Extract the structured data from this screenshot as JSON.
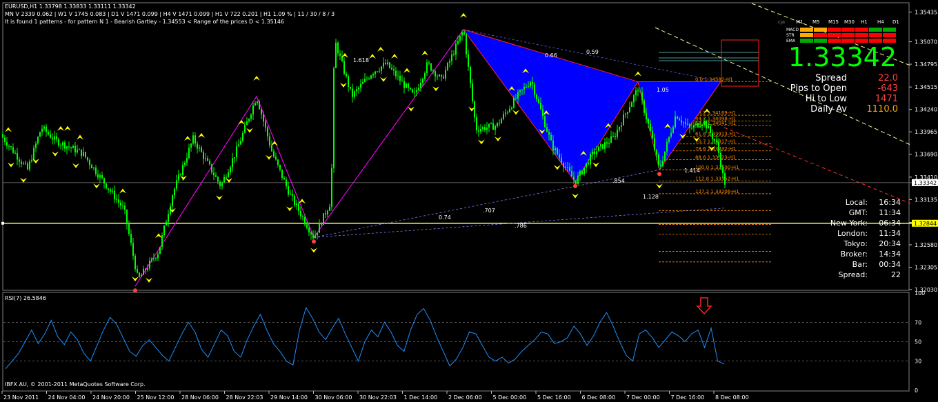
{
  "header": {
    "symbol_line": "EURUSD,H1  1.33798 1.33833 1.33111 1.33342",
    "tf_line": "MN V 2339   0.062  |  W1 V 1745   0.083  |  D1 V 1471   0.099  |  H4 V 1471   0.099  |  H1 V 722   0.201  |  H1   1.09 %  |  11 / 30 / 8 / 3",
    "pattern_line": "It is found 1 patterns  -  for pattern N 1 - Bearish Gartley - 1.34553  < Range of the prices D  < 1.35146"
  },
  "colors": {
    "background": "#000000",
    "candle": "#00ff00",
    "arrow": "#ffff00",
    "pattern_fill": "#0000ff",
    "zigzag": "#ff00ff",
    "fib_level": "#ff8c00",
    "rsi_line": "#1e90ff",
    "price_big": "#00ff00"
  },
  "panel": {
    "price": "1.33342",
    "timeframes": [
      "cja",
      "M1",
      "M5",
      "M15",
      "M30",
      "H1",
      "H4",
      "D1"
    ],
    "indicators": [
      "MACD",
      "STR",
      "EMA"
    ],
    "stats": [
      {
        "label": "Spread",
        "value": "22.0"
      },
      {
        "label": "Pips to Open",
        "value": "-643"
      },
      {
        "label": "Hi to Low",
        "value": "1471"
      },
      {
        "label": "Daily Av",
        "value": "1110.0"
      }
    ],
    "clocks": [
      {
        "label": "Local:",
        "value": "16:34"
      },
      {
        "label": "GMT:",
        "value": "11:34"
      },
      {
        "label": "New York:",
        "value": "06:34"
      },
      {
        "label": "London:",
        "value": "11:34"
      },
      {
        "label": "Tokyo:",
        "value": "20:34"
      },
      {
        "label": "Broker:",
        "value": "14:34"
      },
      {
        "label": "Bar:",
        "value": "00:34"
      },
      {
        "label": "Spread:",
        "value": "22"
      }
    ]
  },
  "fib_labels": [
    {
      "text": "0.0 1.34582-H1",
      "price": 1.34582
    },
    {
      "text": "38.2 1.34169-H1",
      "price": 1.34169
    },
    {
      "text": "44.7 1.34098-H1",
      "price": 1.34098
    },
    {
      "text": "50.0 1.34041-H1",
      "price": 1.34041
    },
    {
      "text": "61.8 1.33913-H1",
      "price": 1.33913
    },
    {
      "text": "70.7 1.33817-H1",
      "price": 1.33817
    },
    {
      "text": "78.6 1.33732-H1",
      "price": 1.33732
    },
    {
      "text": "88.6 1.33623-H1",
      "price": 1.33623
    },
    {
      "text": "100.0 1.33500-H1",
      "price": 1.335
    },
    {
      "text": "112.8 1.33362-H1",
      "price": 1.33362
    },
    {
      "text": "127.2 1.33206-H1",
      "price": 1.33206
    }
  ],
  "ratio_labels": [
    "1.618",
    "0.66",
    "0.59",
    "1.05",
    ".854",
    "1.414",
    "1.128",
    ".707",
    "0.74",
    ".786"
  ],
  "footer": {
    "rsi_label": "RSI(7) 26.5846",
    "copyright": "IBFX AU, © 2001-2011 MetaQuotes Software Corp."
  },
  "chart_data": [
    {
      "type": "candlestick",
      "title": "EURUSD,H1",
      "ylim": [
        1.3203,
        1.3554
      ],
      "y_ticks": [
        "1.35435",
        "1.35070",
        "1.34795",
        "1.34515",
        "1.34240",
        "1.33965",
        "1.33690",
        "1.33410",
        "1.33135",
        "1.32855",
        "1.32580",
        "1.32305",
        "1.32030"
      ],
      "y_tick_values": [
        1.35435,
        1.3507,
        1.34795,
        1.34515,
        1.3424,
        1.33965,
        1.3369,
        1.3341,
        1.33135,
        1.32855,
        1.3258,
        1.32305,
        1.3203
      ],
      "current_price": "1.33342",
      "current_price_value": 1.33342,
      "marked_price": "1.32844",
      "marked_price_value": 1.32844,
      "x_labels": [
        "23 Nov 2011",
        "24 Nov 04:00",
        "24 Nov 20:00",
        "25 Nov 12:00",
        "28 Nov 06:00",
        "28 Nov 22:03",
        "29 Nov 14:00",
        "30 Nov 06:00",
        "30 Nov 22:03",
        "1 Dec 14:00",
        "2 Dec 06:00",
        "5 Dec 00:00",
        "5 Dec 16:00",
        "6 Dec 08:00",
        "7 Dec 00:00",
        "7 Dec 16:00",
        "8 Dec 08:00"
      ],
      "close_path": [
        [
          0,
          1.3394
        ],
        [
          40,
          1.335
        ],
        [
          60,
          1.3402
        ],
        [
          80,
          1.3386
        ],
        [
          120,
          1.337
        ],
        [
          180,
          1.3301
        ],
        [
          200,
          1.3215
        ],
        [
          230,
          1.325
        ],
        [
          250,
          1.332
        ],
        [
          280,
          1.3388
        ],
        [
          320,
          1.333
        ],
        [
          345,
          1.3378
        ],
        [
          372,
          1.344
        ],
        [
          395,
          1.337
        ],
        [
          420,
          1.332
        ],
        [
          455,
          1.3267
        ],
        [
          480,
          1.3312
        ],
        [
          485,
          1.351
        ],
        [
          510,
          1.344
        ],
        [
          540,
          1.347
        ],
        [
          560,
          1.348
        ],
        [
          600,
          1.344
        ],
        [
          620,
          1.348
        ],
        [
          640,
          1.346
        ],
        [
          672,
          1.3522
        ],
        [
          690,
          1.34
        ],
        [
          720,
          1.3404
        ],
        [
          750,
          1.344
        ],
        [
          770,
          1.346
        ],
        [
          800,
          1.338
        ],
        [
          834,
          1.3335
        ],
        [
          860,
          1.337
        ],
        [
          890,
          1.339
        ],
        [
          925,
          1.345
        ],
        [
          945,
          1.339
        ],
        [
          956,
          1.335
        ],
        [
          980,
          1.3418
        ],
        [
          1000,
          1.34
        ],
        [
          1020,
          1.341
        ],
        [
          1040,
          1.338
        ],
        [
          1050,
          1.3334
        ]
      ],
      "zigzag": [
        [
          196,
          1.3207
        ],
        [
          372,
          1.344
        ],
        [
          455,
          1.3267
        ],
        [
          672,
          1.3522
        ],
        [
          834,
          1.3335
        ],
        [
          925,
          1.3458
        ],
        [
          956,
          1.335
        ],
        [
          1045,
          1.3458
        ]
      ],
      "pattern_points": [
        [
          672,
          1.3522
        ],
        [
          834,
          1.3335
        ],
        [
          925,
          1.3458
        ],
        [
          956,
          1.335
        ],
        [
          1045,
          1.3458
        ]
      ]
    },
    {
      "type": "line",
      "title": "RSI(7) 26.5846",
      "ylim": [
        0,
        100
      ],
      "y_ticks": [
        "100",
        "70",
        "50",
        "30",
        "0"
      ],
      "y_tick_values": [
        100,
        70,
        50,
        30,
        0
      ],
      "levels": [
        70,
        50,
        30
      ],
      "current": 26.5846,
      "series": [
        {
          "values": [
            22,
            30,
            38,
            50,
            62,
            48,
            58,
            72,
            55,
            47,
            60,
            52,
            38,
            30,
            46,
            62,
            75,
            68,
            54,
            40,
            35,
            46,
            52,
            44,
            36,
            30,
            44,
            58,
            70,
            60,
            42,
            34,
            48,
            62,
            56,
            40,
            34,
            52,
            66,
            78,
            62,
            48,
            40,
            30,
            26,
            62,
            85,
            74,
            60,
            52,
            64,
            74,
            58,
            44,
            30,
            50,
            62,
            55,
            70,
            60,
            46,
            40,
            62,
            78,
            84,
            72,
            55,
            40,
            25,
            32,
            44,
            60,
            58,
            46,
            34,
            30,
            34,
            28,
            32,
            40,
            46,
            52,
            60,
            58,
            48,
            50,
            54,
            66,
            58,
            46,
            56,
            70,
            80,
            66,
            50,
            36,
            30,
            58,
            62,
            54,
            44,
            52,
            60,
            56,
            50,
            58,
            62,
            44,
            64,
            30,
            27
          ]
        }
      ]
    }
  ]
}
